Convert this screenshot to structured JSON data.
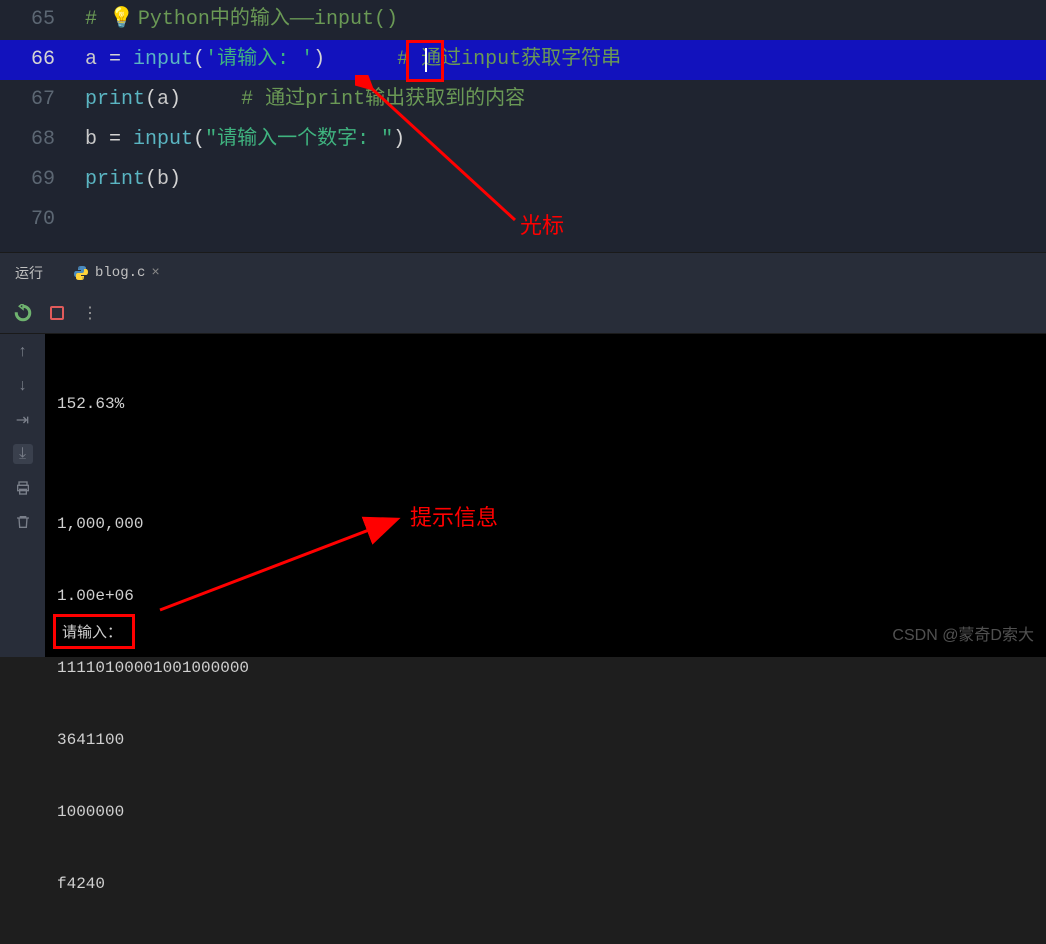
{
  "editor": {
    "lines": [
      {
        "num": "65",
        "hl": false
      },
      {
        "num": "66",
        "hl": true
      },
      {
        "num": "67",
        "hl": false
      },
      {
        "num": "68",
        "hl": false
      },
      {
        "num": "69",
        "hl": false
      },
      {
        "num": "70",
        "hl": false
      }
    ],
    "comment65_prefix": "# ",
    "comment65_text": "Python中的输入——input()",
    "l66_var": "a",
    "l66_eq": " = ",
    "l66_func": "input",
    "l66_paren_open": "(",
    "l66_str": "'请输入: '",
    "l66_paren_close": ")",
    "l66_pad": "      ",
    "l66_comment": "# 通过input获取字符串",
    "l67_func": "print",
    "l67_po": "(",
    "l67_arg": "a",
    "l67_pc": ")",
    "l67_pad": "     ",
    "l67_comment": "# 通过print输出获取到的内容",
    "l68_var": "b",
    "l68_eq": " = ",
    "l68_func": "input",
    "l68_po": "(",
    "l68_str": "\"请输入一个数字: \"",
    "l68_pc": ")",
    "l69_func": "print",
    "l69_po": "(",
    "l69_arg": "b",
    "l69_pc": ")"
  },
  "tabs": {
    "run_label": "运行",
    "file_label": "blog.c"
  },
  "console": {
    "lines": [
      "152.63%",
      "",
      "1,000,000",
      "1.00e+06",
      "11110100001001000000",
      "3641100",
      "1000000",
      "f4240"
    ],
    "prompt": "请输入："
  },
  "annotations": {
    "cursor_label": "光标",
    "prompt_label": "提示信息"
  },
  "watermark": "CSDN @蒙奇D索大"
}
